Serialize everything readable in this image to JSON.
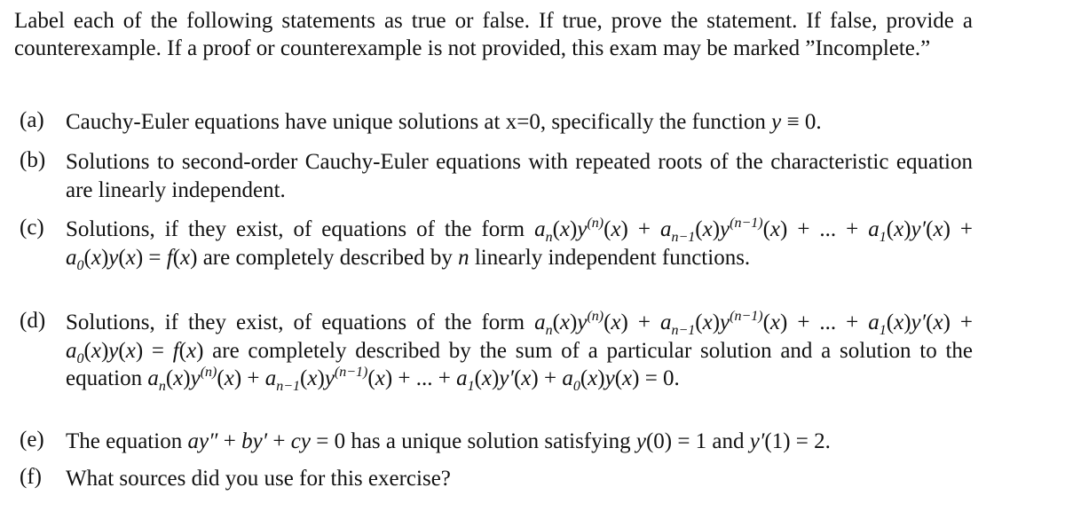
{
  "document": {
    "instructions": "Label each of the following statements as true or false. If true, prove the statement. If false, provide a counterexample. If a proof or counterexample is not provided, this exam may be marked ”Incomplete.”",
    "items": [
      {
        "label": "(a)",
        "segments": [
          {
            "t": "Cauchy-Euler equations have unique solutions at x=0, specifically the function "
          },
          {
            "m": "y"
          },
          {
            "t": " ≡ 0."
          }
        ]
      },
      {
        "label": "(b)",
        "segments": [
          {
            "t": "Solutions to second-order Cauchy-Euler equations with repeated roots of the characteristic equation are linearly independent."
          }
        ]
      },
      {
        "label": "(c)",
        "segments": [
          {
            "t": "Solutions, if they exist, of equations of the form "
          },
          {
            "m": "a"
          },
          {
            "sub": "n"
          },
          {
            "t": "("
          },
          {
            "m": "x"
          },
          {
            "t": ")"
          },
          {
            "m": "y"
          },
          {
            "sup": "(n)"
          },
          {
            "t": "("
          },
          {
            "m": "x"
          },
          {
            "t": ") + "
          },
          {
            "m": "a"
          },
          {
            "sub": "n−1"
          },
          {
            "t": "("
          },
          {
            "m": "x"
          },
          {
            "t": ")"
          },
          {
            "m": "y"
          },
          {
            "sup": "(n−1)"
          },
          {
            "t": "("
          },
          {
            "m": "x"
          },
          {
            "t": ") + ... + "
          },
          {
            "m": "a"
          },
          {
            "sub": "1"
          },
          {
            "t": "("
          },
          {
            "m": "x"
          },
          {
            "t": ")"
          },
          {
            "m": "y′"
          },
          {
            "t": "("
          },
          {
            "m": "x"
          },
          {
            "t": ") + "
          },
          {
            "m": "a"
          },
          {
            "sub": "0"
          },
          {
            "t": "("
          },
          {
            "m": "x"
          },
          {
            "t": ")"
          },
          {
            "m": "y"
          },
          {
            "t": "("
          },
          {
            "m": "x"
          },
          {
            "t": ") = "
          },
          {
            "m": "f"
          },
          {
            "t": "("
          },
          {
            "m": "x"
          },
          {
            "t": ") are completely described by "
          },
          {
            "m": "n"
          },
          {
            "t": " linearly independent functions."
          }
        ]
      },
      {
        "label": "(d)",
        "segments": [
          {
            "t": "Solutions, if they exist, of equations of the form "
          },
          {
            "m": "a"
          },
          {
            "sub": "n"
          },
          {
            "t": "("
          },
          {
            "m": "x"
          },
          {
            "t": ")"
          },
          {
            "m": "y"
          },
          {
            "sup": "(n)"
          },
          {
            "t": "("
          },
          {
            "m": "x"
          },
          {
            "t": ") + "
          },
          {
            "m": "a"
          },
          {
            "sub": "n−1"
          },
          {
            "t": "("
          },
          {
            "m": "x"
          },
          {
            "t": ")"
          },
          {
            "m": "y"
          },
          {
            "sup": "(n−1)"
          },
          {
            "t": "("
          },
          {
            "m": "x"
          },
          {
            "t": ") + ... + "
          },
          {
            "m": "a"
          },
          {
            "sub": "1"
          },
          {
            "t": "("
          },
          {
            "m": "x"
          },
          {
            "t": ")"
          },
          {
            "m": "y′"
          },
          {
            "t": "("
          },
          {
            "m": "x"
          },
          {
            "t": ") + "
          },
          {
            "m": "a"
          },
          {
            "sub": "0"
          },
          {
            "t": "("
          },
          {
            "m": "x"
          },
          {
            "t": ")"
          },
          {
            "m": "y"
          },
          {
            "t": "("
          },
          {
            "m": "x"
          },
          {
            "t": ") = "
          },
          {
            "m": "f"
          },
          {
            "t": "("
          },
          {
            "m": "x"
          },
          {
            "t": ") are completely described by the sum of a particular solution and a solution to the equation "
          },
          {
            "m": "a"
          },
          {
            "sub": "n"
          },
          {
            "t": "("
          },
          {
            "m": "x"
          },
          {
            "t": ")"
          },
          {
            "m": "y"
          },
          {
            "sup": "(n)"
          },
          {
            "t": "("
          },
          {
            "m": "x"
          },
          {
            "t": ") + "
          },
          {
            "m": "a"
          },
          {
            "sub": "n−1"
          },
          {
            "t": "("
          },
          {
            "m": "x"
          },
          {
            "t": ")"
          },
          {
            "m": "y"
          },
          {
            "sup": "(n−1)"
          },
          {
            "t": "("
          },
          {
            "m": "x"
          },
          {
            "t": ") + ... + "
          },
          {
            "m": "a"
          },
          {
            "sub": "1"
          },
          {
            "t": "("
          },
          {
            "m": "x"
          },
          {
            "t": ")"
          },
          {
            "m": "y′"
          },
          {
            "t": "("
          },
          {
            "m": "x"
          },
          {
            "t": ") + "
          },
          {
            "m": "a"
          },
          {
            "sub": "0"
          },
          {
            "t": "("
          },
          {
            "m": "x"
          },
          {
            "t": ")"
          },
          {
            "m": "y"
          },
          {
            "t": "("
          },
          {
            "m": "x"
          },
          {
            "t": ") = 0."
          }
        ]
      },
      {
        "label": "(e)",
        "segments": [
          {
            "t": "The equation "
          },
          {
            "m": "ay″"
          },
          {
            "t": " + "
          },
          {
            "m": "by′"
          },
          {
            "t": " + "
          },
          {
            "m": "cy"
          },
          {
            "t": " = 0 has a unique solution satisfying "
          },
          {
            "m": "y"
          },
          {
            "t": "(0) = 1 and "
          },
          {
            "m": "y′"
          },
          {
            "t": "(1) = 2."
          }
        ]
      },
      {
        "label": "(f)",
        "segments": [
          {
            "t": "What sources did you use for this exercise?"
          }
        ]
      }
    ]
  }
}
